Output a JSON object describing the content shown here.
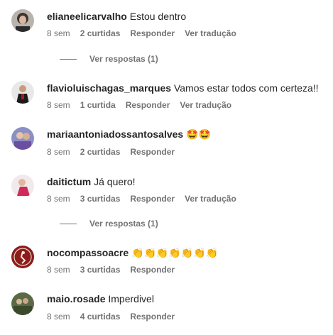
{
  "comments": [
    {
      "username": "elianeelicarvalho",
      "text": "Estou dentro",
      "time": "8 sem",
      "likes": "2 curtidas",
      "reply_label": "Responder",
      "translate_label": "Ver tradução",
      "view_replies": "Ver respostas (1)"
    },
    {
      "username": "flavioluischagas_marques",
      "text": "Vamos estar todos com certeza!!",
      "time": "8 sem",
      "likes": "1 curtida",
      "reply_label": "Responder",
      "translate_label": "Ver tradução"
    },
    {
      "username": "mariaantoniadossantosalves",
      "text": "🤩🤩",
      "time": "8 sem",
      "likes": "2 curtidas",
      "reply_label": "Responder"
    },
    {
      "username": "daitictum",
      "text": "Já quero!",
      "time": "8 sem",
      "likes": "3 curtidas",
      "reply_label": "Responder",
      "translate_label": "Ver tradução",
      "view_replies": "Ver respostas (1)"
    },
    {
      "username": "nocompassoacre",
      "text": "👏👏👏👏👏👏👏",
      "time": "8 sem",
      "likes": "3 curtidas",
      "reply_label": "Responder"
    },
    {
      "username": "maio.rosade",
      "text": "Imperdivel",
      "time": "8 sem",
      "likes": "4 curtidas",
      "reply_label": "Responder"
    }
  ]
}
